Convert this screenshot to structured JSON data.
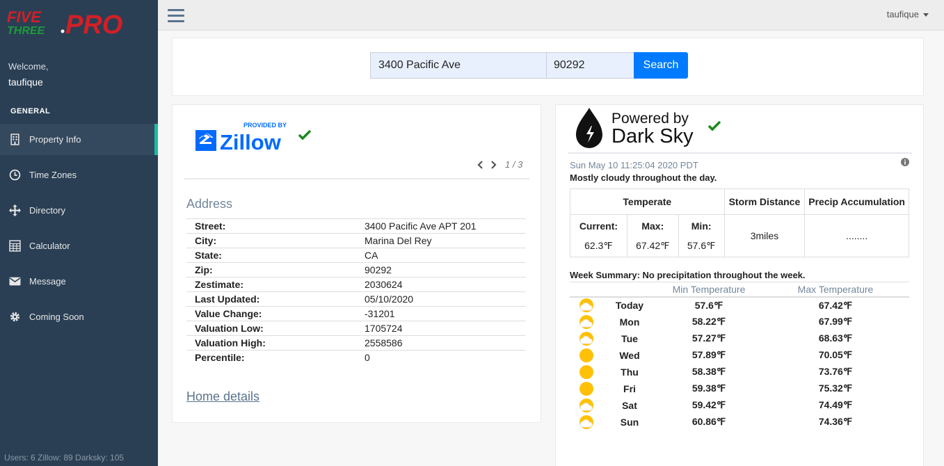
{
  "brand": {
    "logo_text": "FIVE THREE PRO"
  },
  "sidebar": {
    "welcome": "Welcome,",
    "username": "taufique",
    "section": "GENERAL",
    "items": [
      {
        "label": "Property Info",
        "icon": "building-icon"
      },
      {
        "label": "Time Zones",
        "icon": "clock-icon"
      },
      {
        "label": "Directory",
        "icon": "move-arrows-icon"
      },
      {
        "label": "Calculator",
        "icon": "calculator-icon"
      },
      {
        "label": "Message",
        "icon": "envelope-icon"
      },
      {
        "label": "Coming Soon",
        "icon": "gear-icon"
      }
    ],
    "stats": "Users: 6  Zillow: 89  Darksky: 105"
  },
  "topbar": {
    "user": "taufique"
  },
  "search": {
    "street": "3400 Pacific Ave",
    "zip": "90292",
    "button": "Search"
  },
  "zillow": {
    "provided_by": "PROVIDED BY",
    "logo_text": "Zillow",
    "pager": "1 / 3",
    "address_title": "Address",
    "rows": [
      {
        "k": "Street:",
        "v": "3400 Pacific Ave APT 201"
      },
      {
        "k": "City:",
        "v": "Marina Del Rey"
      },
      {
        "k": "State:",
        "v": "CA"
      },
      {
        "k": "Zip:",
        "v": "90292"
      },
      {
        "k": "Zestimate:",
        "v": "2030624"
      },
      {
        "k": "Last Updated:",
        "v": "05/10/2020"
      },
      {
        "k": "Value Change:",
        "v": "-31201"
      },
      {
        "k": "Valuation Low:",
        "v": "1705724"
      },
      {
        "k": "Valuation High:",
        "v": "2558586"
      },
      {
        "k": "Percentile:",
        "v": "0"
      }
    ],
    "home_details": "Home details"
  },
  "darksky": {
    "powered": "Powered by",
    "name": "Dark Sky",
    "time": "Sun May 10 11:25:04 2020 PDT",
    "summary": "Mostly cloudy throughout the day.",
    "table": {
      "temperate": "Temperate",
      "storm_label": "Storm Distance",
      "precip_label": "Precip Accumulation",
      "current_label": "Current:",
      "max_label": "Max:",
      "min_label": "Min:",
      "current": "62.3℉",
      "max": "67.42℉",
      "min": "57.6℉",
      "storm": "3miles",
      "precip": "........"
    },
    "week_summary": "Week Summary: No precipitation throughout the week.",
    "col_min": "Min Temperature",
    "col_max": "Max Temperature",
    "days": [
      {
        "day": "Today",
        "min": "57.6℉",
        "max": "67.42℉",
        "icon": "partly-cloudy-icon"
      },
      {
        "day": "Mon",
        "min": "58.22℉",
        "max": "67.99℉",
        "icon": "partly-cloudy-icon"
      },
      {
        "day": "Tue",
        "min": "57.27℉",
        "max": "68.63℉",
        "icon": "partly-cloudy-icon"
      },
      {
        "day": "Wed",
        "min": "57.89℉",
        "max": "70.05℉",
        "icon": "sun-icon"
      },
      {
        "day": "Thu",
        "min": "58.38℉",
        "max": "73.76℉",
        "icon": "sun-icon"
      },
      {
        "day": "Fri",
        "min": "59.38℉",
        "max": "75.32℉",
        "icon": "sun-icon"
      },
      {
        "day": "Sat",
        "min": "59.42℉",
        "max": "74.49℉",
        "icon": "partly-cloudy-icon"
      },
      {
        "day": "Sun",
        "min": "60.86℉",
        "max": "74.36℉",
        "icon": "partly-cloudy-icon"
      }
    ]
  },
  "colors": {
    "sidebar": "#2a3f54",
    "accent": "#1abb9c",
    "button": "#007bff",
    "check": "#1a8a1a",
    "sun": "#ffc107"
  }
}
